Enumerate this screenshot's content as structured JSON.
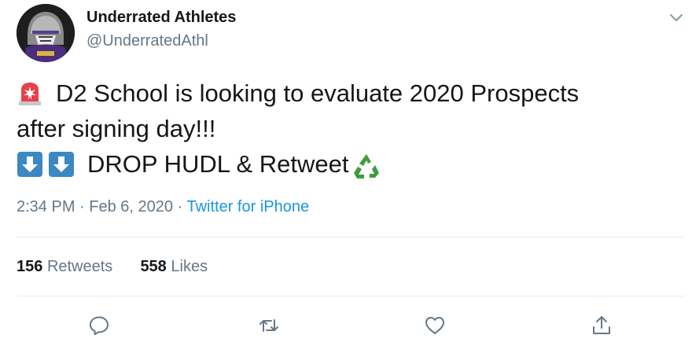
{
  "author": {
    "name": "Underrated Athletes",
    "handle": "@UnderratedAthl",
    "avatar_icon": "football-player-avatar"
  },
  "tweet": {
    "line1": "D2 School is looking to evaluate 2020 Prospects",
    "line2": "after signing day!!!",
    "line3": "DROP HUDL & Retweet",
    "emojis": [
      "police-light-emoji",
      "down-arrow-emoji",
      "down-arrow-emoji",
      "recycle-emoji"
    ]
  },
  "meta": {
    "time": "2:34 PM",
    "sep1": "·",
    "date": "Feb 6, 2020",
    "sep2": "·",
    "source": "Twitter for iPhone"
  },
  "stats": {
    "retweets_count": "156",
    "retweets_label": "Retweets",
    "likes_count": "558",
    "likes_label": "Likes"
  },
  "actions": [
    "reply-icon",
    "retweet-icon",
    "like-icon",
    "share-icon"
  ],
  "colors": {
    "text": "#14171a",
    "secondary": "#657786",
    "link": "#1b95e0",
    "divider": "#e6ecf0"
  }
}
